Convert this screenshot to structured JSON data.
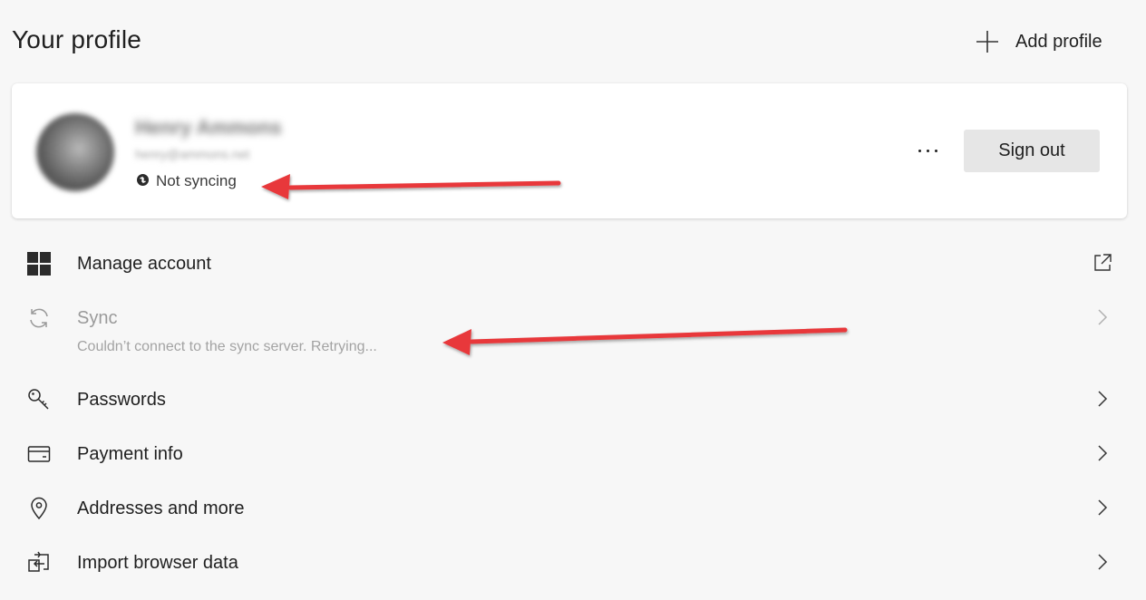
{
  "header": {
    "title": "Your profile",
    "add_profile_label": "Add profile"
  },
  "profile": {
    "name": "Henry Ammons",
    "email": "henry@ammons.net",
    "sync_status": "Not syncing",
    "sign_out_label": "Sign out",
    "more_icon": "more-horizontal-icon"
  },
  "menu": [
    {
      "label": "Manage account",
      "icon": "windows-grid-icon",
      "trailing": "external-link-icon"
    },
    {
      "label": "Sync",
      "sublabel": "Couldn’t connect to the sync server. Retrying...",
      "icon": "sync-icon",
      "trailing": "chevron-right-icon",
      "disabled": true
    },
    {
      "label": "Passwords",
      "icon": "key-icon",
      "trailing": "chevron-right-icon"
    },
    {
      "label": "Payment info",
      "icon": "credit-card-icon",
      "trailing": "chevron-right-icon"
    },
    {
      "label": "Addresses and more",
      "icon": "location-pin-icon",
      "trailing": "chevron-right-icon"
    },
    {
      "label": "Import browser data",
      "icon": "import-icon",
      "trailing": "chevron-right-icon"
    }
  ],
  "colors": {
    "background": "#f7f7f7",
    "card": "#ffffff",
    "annotation_arrow": "#e8383b",
    "disabled_text": "#9a9a9a"
  }
}
